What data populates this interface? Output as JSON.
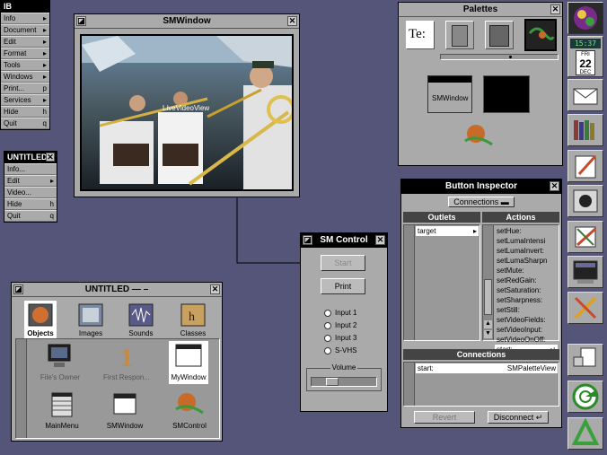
{
  "main_menu": {
    "title": "IB",
    "items": [
      {
        "label": "Info",
        "key": "▸"
      },
      {
        "label": "Document",
        "key": "▸"
      },
      {
        "label": "Edit",
        "key": "▸"
      },
      {
        "label": "Format",
        "key": "▸"
      },
      {
        "label": "Tools",
        "key": "▸"
      },
      {
        "label": "Windows",
        "key": "▸"
      },
      {
        "label": "Print...",
        "key": "p"
      },
      {
        "label": "Services",
        "key": "▸"
      },
      {
        "label": "Hide",
        "key": "h"
      },
      {
        "label": "Quit",
        "key": "q"
      }
    ]
  },
  "doc_menu": {
    "title": "UNTITLED",
    "items": [
      {
        "label": "Info...",
        "key": ""
      },
      {
        "label": "Edit",
        "key": "▸"
      },
      {
        "label": "Video...",
        "key": ""
      },
      {
        "label": "Hide",
        "key": "h"
      },
      {
        "label": "Quit",
        "key": "q"
      }
    ]
  },
  "smwindow": {
    "title": "SMWindow",
    "video_label": "LiveVideoView"
  },
  "palettes": {
    "title": "Palettes",
    "smwindow_btn": "SMWindow",
    "tool_icons": [
      "text-tool-icon",
      "cabinet-icon",
      "slider-tool-icon",
      "sound-palette-icon"
    ]
  },
  "inspector": {
    "title": "Button Inspector",
    "popup": "Connections",
    "outlets_header": "Outlets",
    "actions_header": "Actions",
    "outlets": [
      "target"
    ],
    "actions": [
      "setHue:",
      "setLumaIntensi",
      "setLumaInvert:",
      "setLumaSharpn",
      "setMute:",
      "setRedGain:",
      "setSaturation:",
      "setSharpness:",
      "setStill:",
      "setVideoFields:",
      "setVideoInput:",
      "setVideoOnOff:",
      "start:"
    ],
    "connections_header": "Connections",
    "connection": {
      "action": "start:",
      "target": "SMPaletteView"
    },
    "revert": "Revert",
    "disconnect": "Disconnect"
  },
  "smcontrol": {
    "title": "SM Control",
    "start": "Start",
    "print": "Print",
    "inputs": [
      "Input 1",
      "Input 2",
      "Input 3",
      "S-VHS"
    ],
    "volume": "Volume"
  },
  "file_window": {
    "title": "UNTITLED — –",
    "tabs": [
      "Objects",
      "Images",
      "Sounds",
      "Classes"
    ],
    "icons": [
      {
        "label": "File's Owner"
      },
      {
        "label": "First Respon..."
      },
      {
        "label": "MyWindow"
      },
      {
        "label": "MainMenu"
      },
      {
        "label": "SMWindow"
      },
      {
        "label": "SMControl"
      }
    ]
  },
  "dock": {
    "clock": "15:37",
    "day": "FRI",
    "date": "22",
    "month": "DEC"
  },
  "colors": {
    "desktop": "#55557a",
    "window": "#aaaaaa",
    "title_active": "#000000",
    "highlight": "#ffffff"
  }
}
